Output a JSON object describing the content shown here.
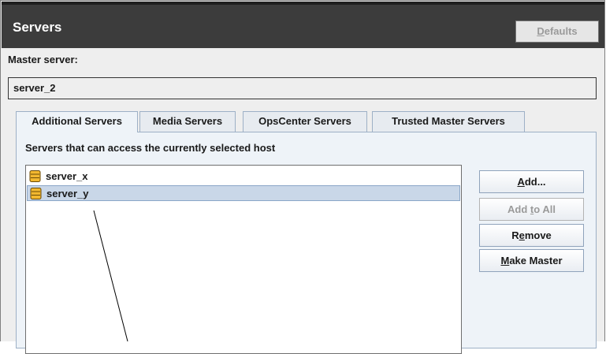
{
  "header": {
    "title": "Servers",
    "defaults_pre": "",
    "defaults_accel": "D",
    "defaults_post": "efaults"
  },
  "master": {
    "label": "Master server:",
    "value": "server_2"
  },
  "tabs": [
    {
      "label": "Additional Servers",
      "active": true
    },
    {
      "label": "Media Servers",
      "active": false
    },
    {
      "label": "OpsCenter Servers",
      "active": false
    },
    {
      "label": "Trusted Master Servers",
      "active": false
    }
  ],
  "panel": {
    "label": "Servers that can access the currently selected host",
    "servers": [
      {
        "name": "server_x",
        "selected": false
      },
      {
        "name": "server_y",
        "selected": true
      }
    ],
    "icon": "server-icon"
  },
  "buttons": {
    "add": {
      "pre": "",
      "accel": "A",
      "post": "dd...",
      "enabled": true
    },
    "add_to_all": {
      "pre": "Add ",
      "accel": "t",
      "post": "o All",
      "enabled": false
    },
    "remove": {
      "pre": "R",
      "accel": "e",
      "post": "move",
      "enabled": true
    },
    "make_master": {
      "pre": "",
      "accel": "M",
      "post": "ake Master",
      "enabled": true
    }
  },
  "colors": {
    "titlebar": "#3c3c3c",
    "selection": "#c9d7e8",
    "tab_border": "#9db0c6"
  }
}
